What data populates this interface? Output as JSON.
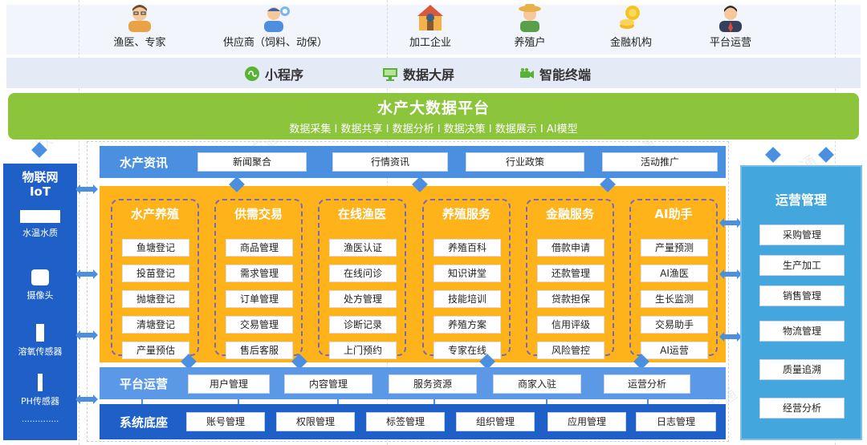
{
  "roles": [
    {
      "label": "渔医、专家",
      "icon": "doctor-expert-icon",
      "color": "#f0a050"
    },
    {
      "label": "供应商（饲料、动保）",
      "icon": "supplier-icon",
      "color": "#5aa0e8"
    },
    {
      "label": "加工企业",
      "icon": "factory-icon",
      "color": "#e07b39"
    },
    {
      "label": "养殖户",
      "icon": "farmer-icon",
      "color": "#f4a640"
    },
    {
      "label": "金融机构",
      "icon": "coin-icon",
      "color": "#f3c21c"
    },
    {
      "label": "平台运营",
      "icon": "operator-icon",
      "color": "#3d4c68"
    }
  ],
  "channels": [
    {
      "label": "小程序",
      "icon": "mini-program-icon",
      "color": "#58b233"
    },
    {
      "label": "数据大屏",
      "icon": "big-screen-icon",
      "color": "#58b233"
    },
    {
      "label": "智能终端",
      "icon": "camera-device-icon",
      "color": "#58b233"
    }
  ],
  "bigdata": {
    "title": "水产大数据平台",
    "subtitle": "数据采集 I 数据共享 I 数据分析 I 数据决策 I 数据展示 I AI模型"
  },
  "iot": {
    "title_line1": "物联网",
    "title_line2": "IoT",
    "devices": [
      {
        "label": "水温水质",
        "icon": "water-sensor-icon"
      },
      {
        "label": "摄像头",
        "icon": "camera-icon"
      },
      {
        "label": "溶氧传感器",
        "icon": "oxygen-sensor-icon"
      },
      {
        "label": "PH传感器",
        "icon": "ph-sensor-icon"
      }
    ],
    "more": "………….."
  },
  "news": {
    "label": "水产资讯",
    "items": [
      "新闻聚合",
      "行情资讯",
      "行业政策",
      "活动推广"
    ]
  },
  "modules": [
    {
      "title": "水产养殖",
      "items": [
        "鱼塘登记",
        "投苗登记",
        "抛塘登记",
        "清塘登记",
        "产量预估"
      ]
    },
    {
      "title": "供需交易",
      "items": [
        "商品管理",
        "需求管理",
        "订单管理",
        "交易管理",
        "售后客服"
      ]
    },
    {
      "title": "在线渔医",
      "items": [
        "渔医认证",
        "在线问诊",
        "处方管理",
        "诊断记录",
        "上门预约"
      ]
    },
    {
      "title": "养殖服务",
      "items": [
        "养殖百科",
        "知识讲堂",
        "技能培训",
        "养殖方案",
        "专家在线"
      ]
    },
    {
      "title": "金融服务",
      "items": [
        "借款申请",
        "还款管理",
        "贷款担保",
        "信用评级",
        "风险管控"
      ]
    },
    {
      "title": "AI助手",
      "items": [
        "产量预测",
        "AI渔医",
        "生长监测",
        "交易助手",
        "AI运营"
      ]
    }
  ],
  "platform": {
    "label": "平台运营",
    "items": [
      "用户管理",
      "内容管理",
      "服务资源",
      "商家入驻",
      "运营分析"
    ]
  },
  "base": {
    "label": "系统底座",
    "items": [
      "账号管理",
      "权限管理",
      "标签管理",
      "组织管理",
      "应用管理",
      "日志管理"
    ]
  },
  "ops": {
    "title": "运营管理",
    "items": [
      "采购管理",
      "生产加工",
      "销售管理",
      "物流管理",
      "质量追溯",
      "经营分析"
    ]
  },
  "watermark": "欣农通",
  "colors": {
    "green": "#8cc43c",
    "blue_dark": "#1f5fc8",
    "blue_mid": "#4a8fe0",
    "orange": "#ffb31a",
    "ops_blue": "#43a6dd",
    "module_border": "#7a67b8"
  }
}
